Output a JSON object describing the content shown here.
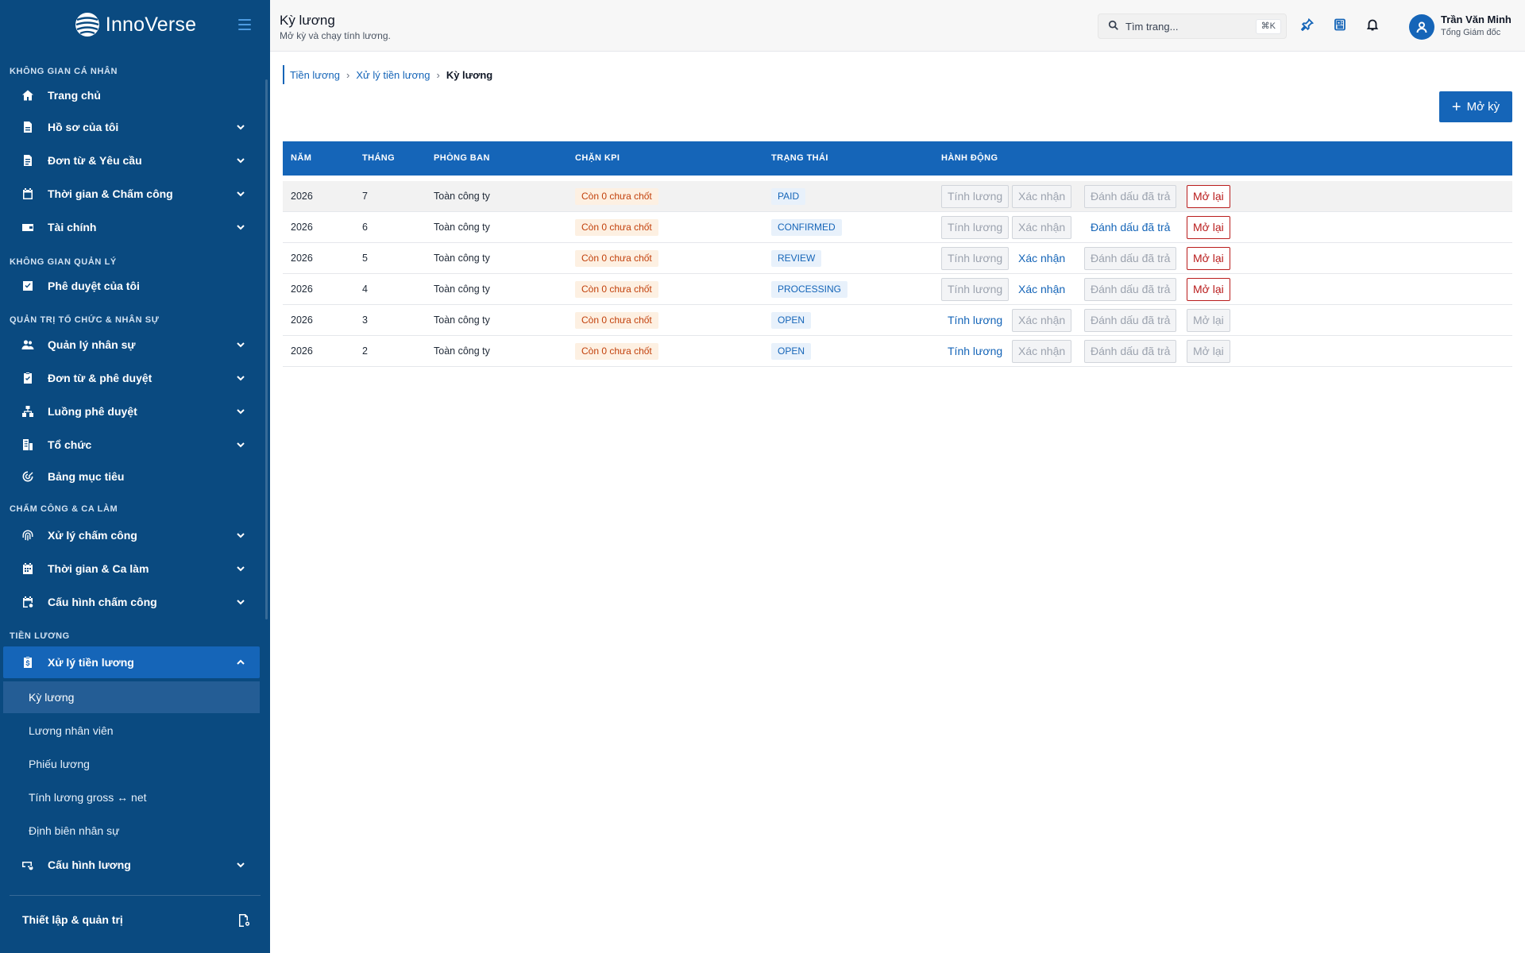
{
  "brand": {
    "name": "InnoVerse",
    "accent": "#0a4a80"
  },
  "sidebar": {
    "sections": [
      {
        "label": "KHÔNG GIAN CÁ NHÂN"
      },
      {
        "label": "KHÔNG GIAN QUẢN LÝ"
      },
      {
        "label": "QUẢN TRỊ TỔ CHỨC & NHÂN SỰ"
      },
      {
        "label": "CHẤM CÔNG & CA LÀM"
      },
      {
        "label": "TIỀN LƯƠNG"
      }
    ],
    "items": [
      {
        "label": "Trang chủ",
        "icon": "home-icon"
      },
      {
        "label": "Hồ sơ của tôi",
        "icon": "file-icon"
      },
      {
        "label": "Đơn từ & Yêu cầu",
        "icon": "document-icon"
      },
      {
        "label": "Thời gian & Chấm công",
        "icon": "calendar-icon"
      },
      {
        "label": "Tài chính",
        "icon": "wallet-icon"
      },
      {
        "label": "Phê duyệt của tôi",
        "icon": "check-square-icon"
      },
      {
        "label": "Quản lý nhân sự",
        "icon": "users-icon"
      },
      {
        "label": "Đơn từ & phê duyệt",
        "icon": "clipboard-check-icon"
      },
      {
        "label": "Luồng phê duyệt",
        "icon": "flow-icon"
      },
      {
        "label": "Tổ chức",
        "icon": "building-icon"
      },
      {
        "label": "Bảng mục tiêu",
        "icon": "target-icon"
      },
      {
        "label": "Xử lý chấm công",
        "icon": "fingerprint-icon"
      },
      {
        "label": "Thời gian & Ca làm",
        "icon": "calendar-grid-icon"
      },
      {
        "label": "Cấu hình chấm công",
        "icon": "calendar-settings-icon"
      },
      {
        "label": "Xử lý tiền lương",
        "icon": "payroll-icon"
      },
      {
        "label": "Cấu hình lương",
        "icon": "cash-settings-icon"
      }
    ],
    "sub_items": [
      {
        "label": "Kỳ lương"
      },
      {
        "label": "Lương nhân viên"
      },
      {
        "label": "Phiếu lương"
      },
      {
        "label": "Tính lương gross ↔ net"
      },
      {
        "label": "Định biên nhân sự"
      }
    ],
    "footer": {
      "label": "Thiết lập & quản trị"
    }
  },
  "header": {
    "title": "Kỳ lương",
    "subtitle": "Mở kỳ và chạy tính lương.",
    "search": {
      "placeholder": "Tìm trang...",
      "shortcut": "⌘K"
    },
    "user": {
      "name": "Trần Văn Minh",
      "role": "Tổng Giám đốc"
    }
  },
  "breadcrumb": {
    "items": [
      "Tiền lương",
      "Xử lý tiền lương"
    ],
    "current": "Kỳ lương"
  },
  "toolbar": {
    "open_period_label": "Mở kỳ"
  },
  "table": {
    "columns": [
      "NĂM",
      "THÁNG",
      "PHÒNG BAN",
      "CHẶN KPI",
      "TRẠNG THÁI",
      "HÀNH ĐỘNG"
    ],
    "rows": [
      {
        "year": "2026",
        "month": "7",
        "dept": "Toàn công ty",
        "kpi": "Còn 0 chưa chốt",
        "status": "PAID",
        "actions": [
          {
            "label": "Tính lương",
            "state": "disabled"
          },
          {
            "label": "Xác nhận",
            "state": "disabled"
          },
          {
            "label": "Đánh dấu đã trả",
            "state": "disabled"
          },
          {
            "label": "Mở lại",
            "state": "danger"
          }
        ]
      },
      {
        "year": "2026",
        "month": "6",
        "dept": "Toàn công ty",
        "kpi": "Còn 0 chưa chốt",
        "status": "CONFIRMED",
        "actions": [
          {
            "label": "Tính lương",
            "state": "disabled"
          },
          {
            "label": "Xác nhận",
            "state": "disabled"
          },
          {
            "label": "Đánh dấu đã trả",
            "state": "enabled"
          },
          {
            "label": "Mở lại",
            "state": "danger"
          }
        ]
      },
      {
        "year": "2026",
        "month": "5",
        "dept": "Toàn công ty",
        "kpi": "Còn 0 chưa chốt",
        "status": "REVIEW",
        "actions": [
          {
            "label": "Tính lương",
            "state": "disabled"
          },
          {
            "label": "Xác nhận",
            "state": "enabled"
          },
          {
            "label": "Đánh dấu đã trả",
            "state": "disabled"
          },
          {
            "label": "Mở lại",
            "state": "danger"
          }
        ]
      },
      {
        "year": "2026",
        "month": "4",
        "dept": "Toàn công ty",
        "kpi": "Còn 0 chưa chốt",
        "status": "PROCESSING",
        "actions": [
          {
            "label": "Tính lương",
            "state": "disabled"
          },
          {
            "label": "Xác nhận",
            "state": "enabled"
          },
          {
            "label": "Đánh dấu đã trả",
            "state": "disabled"
          },
          {
            "label": "Mở lại",
            "state": "danger"
          }
        ]
      },
      {
        "year": "2026",
        "month": "3",
        "dept": "Toàn công ty",
        "kpi": "Còn 0 chưa chốt",
        "status": "OPEN",
        "actions": [
          {
            "label": "Tính lương",
            "state": "enabled"
          },
          {
            "label": "Xác nhận",
            "state": "disabled"
          },
          {
            "label": "Đánh dấu đã trả",
            "state": "disabled"
          },
          {
            "label": "Mở lại",
            "state": "disabled"
          }
        ]
      },
      {
        "year": "2026",
        "month": "2",
        "dept": "Toàn công ty",
        "kpi": "Còn 0 chưa chốt",
        "status": "OPEN",
        "actions": [
          {
            "label": "Tính lương",
            "state": "enabled"
          },
          {
            "label": "Xác nhận",
            "state": "disabled"
          },
          {
            "label": "Đánh dấu đã trả",
            "state": "disabled"
          },
          {
            "label": "Mở lại",
            "state": "disabled"
          }
        ]
      }
    ]
  },
  "colors": {
    "primary": "#1565b8",
    "sidebar": "#0a4a80",
    "danger": "#b91c1c",
    "kpi_text": "#c2410c",
    "kpi_bg": "#fdf0e2"
  }
}
